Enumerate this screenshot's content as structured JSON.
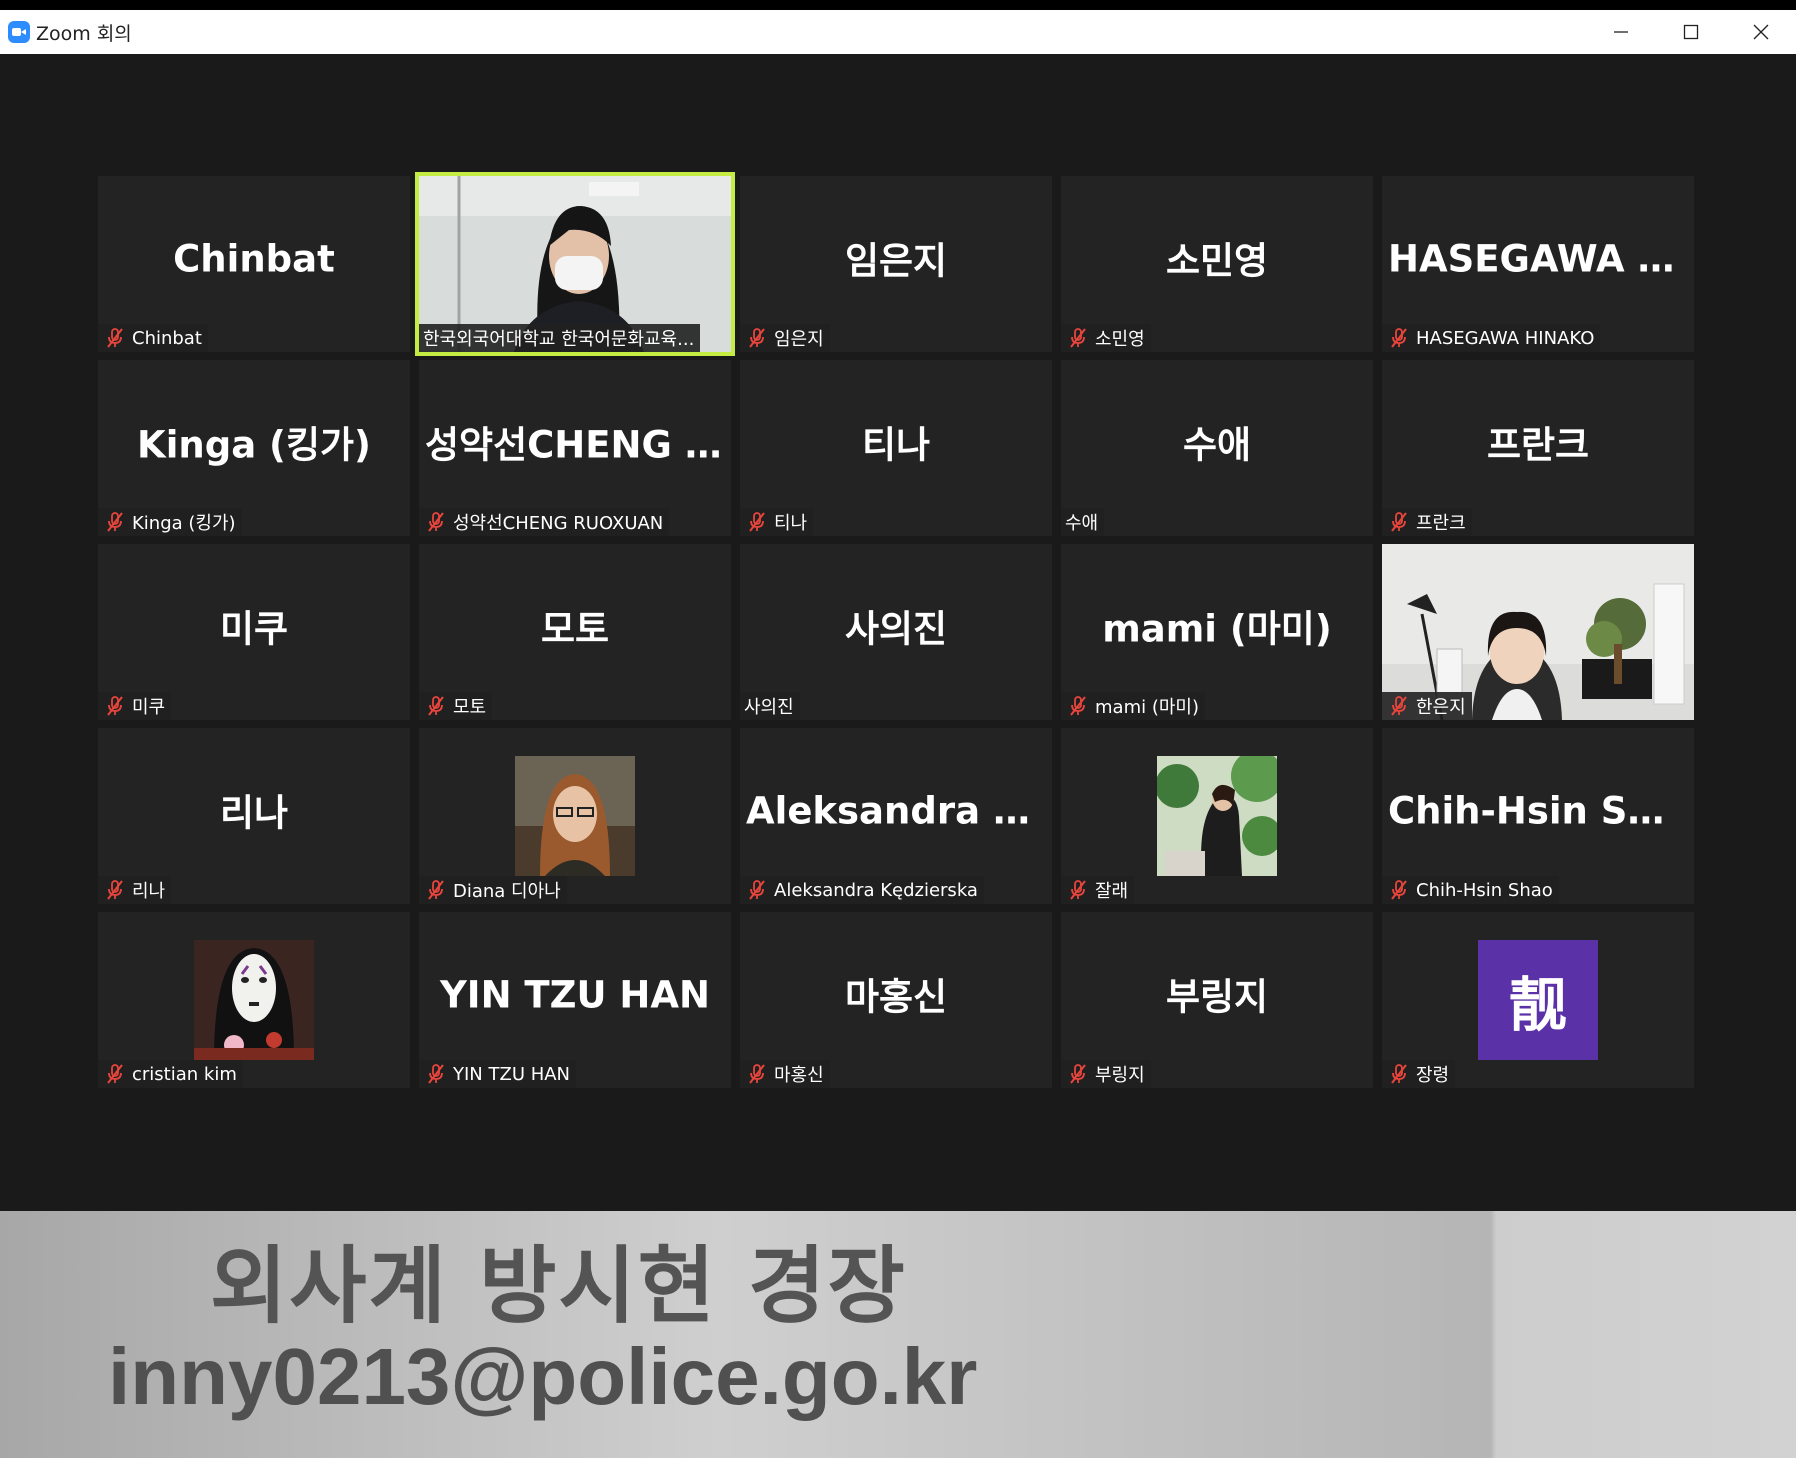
{
  "window": {
    "title": "Zoom 회의"
  },
  "participants": [
    {
      "display": "Chinbat",
      "label": "Chinbat",
      "muted": true,
      "kind": "name"
    },
    {
      "display": "",
      "label": "한국외국어대학교 한국어문화교육...",
      "muted": false,
      "kind": "video-woman-mask",
      "active": true
    },
    {
      "display": "임은지",
      "label": "임은지",
      "muted": true,
      "kind": "name"
    },
    {
      "display": "소민영",
      "label": "소민영",
      "muted": true,
      "kind": "name"
    },
    {
      "display": "HASEGAWA HI...",
      "label": "HASEGAWA HINAKO",
      "muted": true,
      "kind": "name"
    },
    {
      "display": "Kinga (킹가)",
      "label": "Kinga (킹가)",
      "muted": true,
      "kind": "name"
    },
    {
      "display": "성약선CHENG R...",
      "label": "성약선CHENG RUOXUAN",
      "muted": true,
      "kind": "name"
    },
    {
      "display": "티나",
      "label": "티나",
      "muted": true,
      "kind": "name"
    },
    {
      "display": "수애",
      "label": "수애",
      "muted": false,
      "kind": "name"
    },
    {
      "display": "프란크",
      "label": "프란크",
      "muted": true,
      "kind": "name"
    },
    {
      "display": "미쿠",
      "label": "미쿠",
      "muted": true,
      "kind": "name"
    },
    {
      "display": "모토",
      "label": "모토",
      "muted": true,
      "kind": "name"
    },
    {
      "display": "사의진",
      "label": "사의진",
      "muted": false,
      "kind": "name"
    },
    {
      "display": "mami (마미)",
      "label": "mami (마미)",
      "muted": true,
      "kind": "name"
    },
    {
      "display": "",
      "label": "한은지",
      "muted": true,
      "kind": "video-room"
    },
    {
      "display": "리나",
      "label": "리나",
      "muted": true,
      "kind": "name"
    },
    {
      "display": "",
      "label": "Diana 디아나",
      "muted": true,
      "kind": "avatar-portrait"
    },
    {
      "display": "Aleksandra Kęd...",
      "label": "Aleksandra Kędzierska",
      "muted": true,
      "kind": "name"
    },
    {
      "display": "",
      "label": "잘래",
      "muted": true,
      "kind": "avatar-plant"
    },
    {
      "display": "Chih-Hsin Shao",
      "label": "Chih-Hsin Shao",
      "muted": true,
      "kind": "name"
    },
    {
      "display": "",
      "label": "cristian kim",
      "muted": true,
      "kind": "avatar-noface"
    },
    {
      "display": "YIN TZU HAN",
      "label": "YIN TZU HAN",
      "muted": true,
      "kind": "name"
    },
    {
      "display": "마홍신",
      "label": "마홍신",
      "muted": true,
      "kind": "name"
    },
    {
      "display": "부링지",
      "label": "부링지",
      "muted": true,
      "kind": "name"
    },
    {
      "display": "靓",
      "label": "장령",
      "muted": true,
      "kind": "avatar-glyph"
    }
  ],
  "banner": {
    "line1": "외사계 방시현 경장",
    "line2": "inny0213@police.go.kr"
  },
  "colors": {
    "active_speaker": "#c5ec43",
    "muted_icon": "#e8453c",
    "glyph_avatar": "#5b31a8"
  }
}
